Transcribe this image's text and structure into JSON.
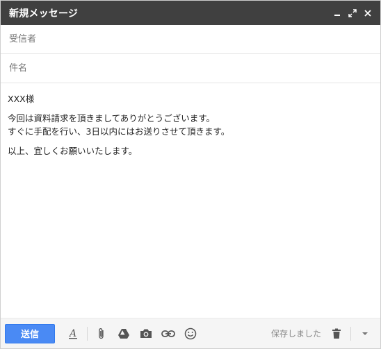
{
  "window": {
    "title": "新規メッセージ",
    "controls": [
      "minimize-icon",
      "expand-icon",
      "close-icon"
    ]
  },
  "fields": {
    "to_placeholder": "受信者",
    "subject_placeholder": "件名"
  },
  "body": {
    "greeting": "XXX様",
    "line1": "今回は資料請求を頂きましてありがとうございます。",
    "line2": "すぐに手配を行い、3日以内にはお送りさせて頂きます。",
    "closing": "以上、宜しくお願いいたします。"
  },
  "toolbar": {
    "send_label": "送信",
    "saved_label": "保存しました",
    "icons": [
      "format-text-icon",
      "attach-icon",
      "drive-icon",
      "photo-icon",
      "link-icon",
      "emoji-icon",
      "trash-icon",
      "more-options-icon"
    ]
  },
  "colors": {
    "titlebar": "#404040",
    "send_button": "#4a8af4",
    "toolbar_bg": "#f5f5f5"
  }
}
